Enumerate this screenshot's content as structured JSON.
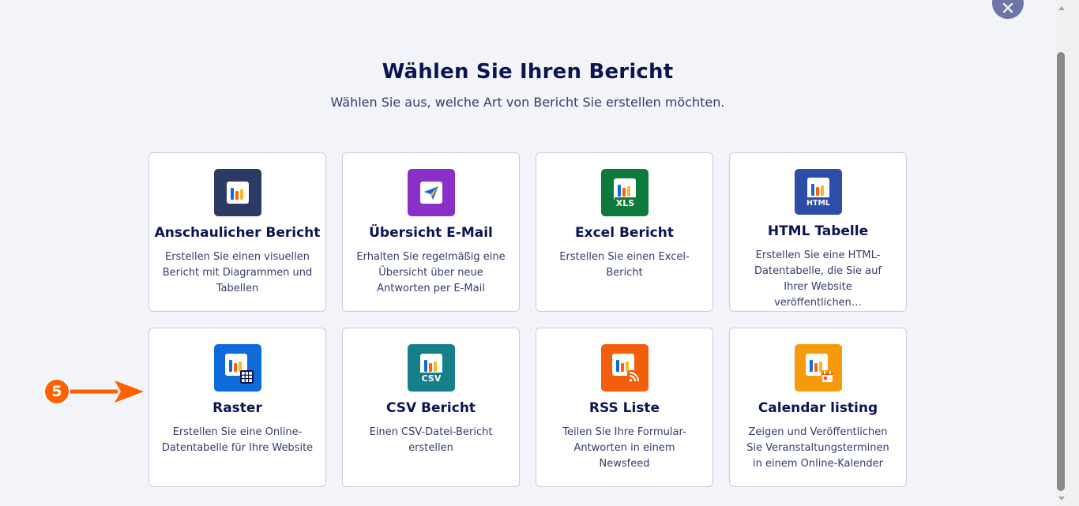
{
  "header": {
    "title": "Wählen Sie Ihren Bericht",
    "subtitle": "Wählen Sie aus, welche Art von Bericht Sie erstellen möchten."
  },
  "reports": [
    {
      "title": "Anschaulicher Bericht",
      "description": "Erstellen Sie einen visuellen Bericht mit Diagrammen und Tabellen",
      "icon": "visual-report-icon",
      "color": "#2d3a63"
    },
    {
      "title": "Übersicht E-Mail",
      "description": "Erhalten Sie regelmäßig eine Übersicht über neue Antworten per E-Mail",
      "icon": "email-digest-icon",
      "color": "#8a2fc9"
    },
    {
      "title": "Excel Bericht",
      "description": "Erstellen Sie einen Excel-Bericht",
      "icon": "excel-report-icon",
      "color": "#0b7a3b",
      "badge": "XLS"
    },
    {
      "title": "HTML Tabelle",
      "description": "Erstellen Sie eine HTML-Datentabelle, die Sie auf Ihrer Website veröffentlichen…",
      "icon": "html-table-icon",
      "color": "#2d4ea8",
      "badge": "HTML"
    },
    {
      "title": "Raster",
      "description": "Erstellen Sie eine Online-Datentabelle für Ihre Website",
      "icon": "grid-report-icon",
      "color": "#0f6bd9"
    },
    {
      "title": "CSV Bericht",
      "description": "Einen CSV-Datei-Bericht erstellen",
      "icon": "csv-report-icon",
      "color": "#15808a",
      "badge": "CSV"
    },
    {
      "title": "RSS Liste",
      "description": "Teilen Sie Ihre Formular-Antworten in einem Newsfeed",
      "icon": "rss-list-icon",
      "color": "#f25e0c"
    },
    {
      "title": "Calendar listing",
      "description": "Zeigen und Veröffentlichen Sie Veranstaltungsterminen in einem Online-Kalender",
      "icon": "calendar-listing-icon",
      "color": "#f59a0b"
    }
  ],
  "step_marker": {
    "number": "5",
    "color": "#ff6100"
  },
  "close_button": {
    "icon": "close-icon"
  }
}
